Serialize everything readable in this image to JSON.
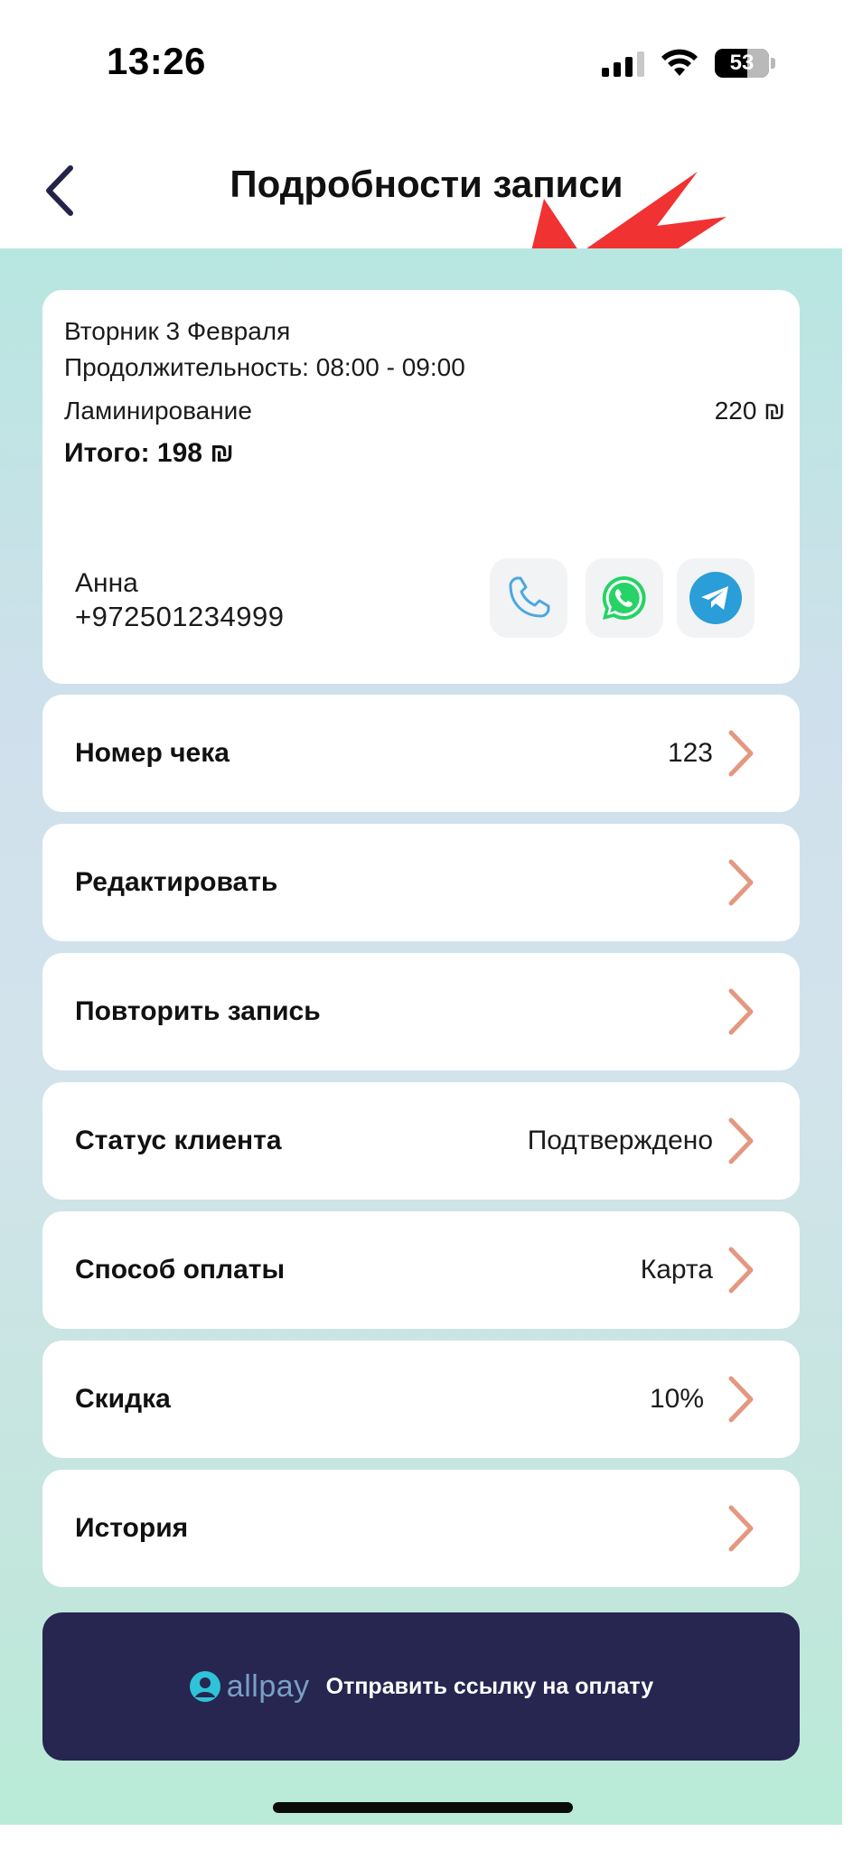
{
  "status_bar": {
    "time": "13:26",
    "battery": "53",
    "icons": [
      "signal-icon",
      "wifi-icon",
      "battery-icon"
    ]
  },
  "header": {
    "title": "Подробности записи",
    "back_icon": "chevron-left-icon"
  },
  "appointment": {
    "date": "Вторник 3 Февраля",
    "duration": "Продолжительность: 08:00 - 09:00",
    "service": "Ламинирование",
    "service_price": "220 ₪",
    "total": "Итого: 198 ₪"
  },
  "client": {
    "name": "Анна",
    "phone": "+972501234999",
    "contacts": [
      "phone-icon",
      "whatsapp-icon",
      "telegram-icon"
    ]
  },
  "rows": [
    {
      "label": "Номер чека",
      "value": "123"
    },
    {
      "label": "Редактировать",
      "value": ""
    },
    {
      "label": "Повторить запись",
      "value": ""
    },
    {
      "label": "Статус клиента",
      "value": "Подтверждено"
    },
    {
      "label": "Способ оплаты",
      "value": "Карта"
    },
    {
      "label": "Скидка",
      "value": "10%"
    },
    {
      "label": "История",
      "value": ""
    }
  ],
  "payment": {
    "logo": "allpay",
    "label": "Отправить ссылку на оплату"
  },
  "colors": {
    "accent_chevron": "#e3987f",
    "pay_button": "#262650",
    "annotation_arrow": "#f03232",
    "phone_icon": "#4aa8e0",
    "whatsapp": "#25d366",
    "telegram": "#2a9ed8"
  }
}
